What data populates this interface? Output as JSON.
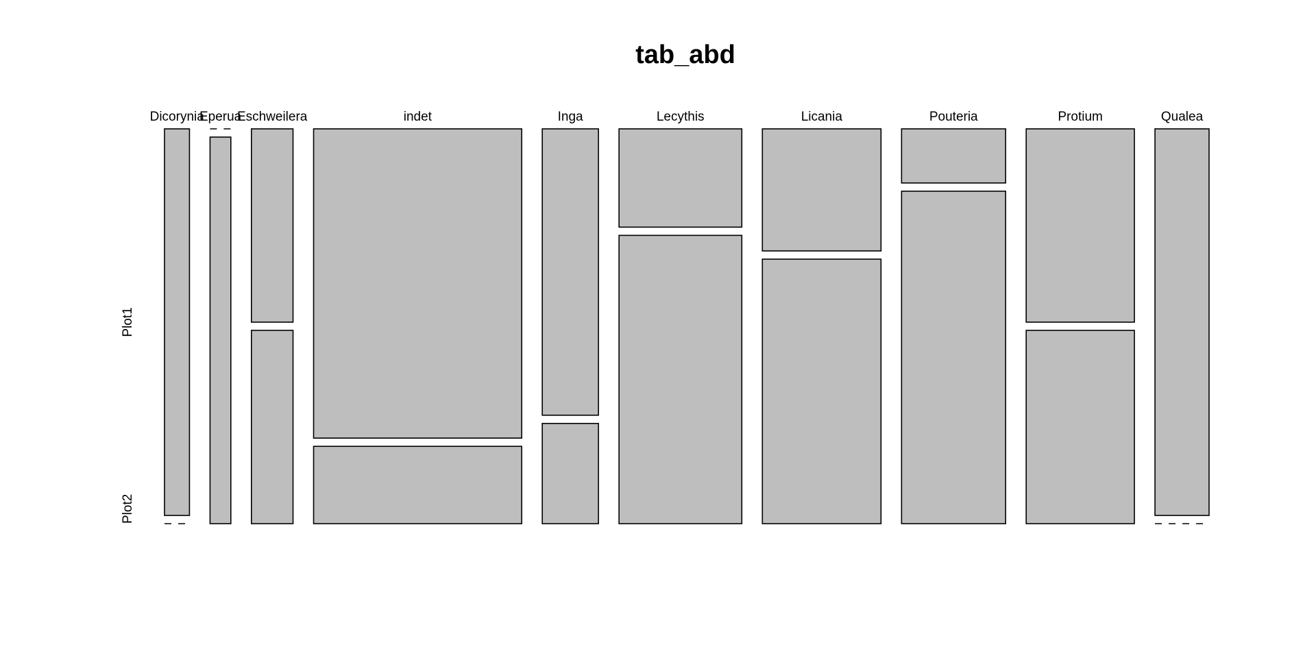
{
  "chart_data": {
    "type": "mosaic",
    "title": "tab_abd",
    "xlabel": "",
    "ylabel": "",
    "categories": [
      "Dicorynia",
      "Eperua",
      "Eschweilera",
      "indet",
      "Inga",
      "Lecythis",
      "Licania",
      "Pouteria",
      "Protium",
      "Qualea"
    ],
    "rows": [
      "Plot1",
      "Plot2"
    ],
    "values": [
      [
        12,
        0
      ],
      [
        0,
        10
      ],
      [
        10,
        10
      ],
      [
        80,
        20
      ],
      [
        20,
        7
      ],
      [
        15,
        44
      ],
      [
        18,
        39
      ],
      [
        7,
        43
      ],
      [
        26,
        26
      ],
      [
        26,
        0
      ]
    ],
    "colors": {
      "fill": "#bebebe",
      "stroke": "#000000"
    }
  }
}
